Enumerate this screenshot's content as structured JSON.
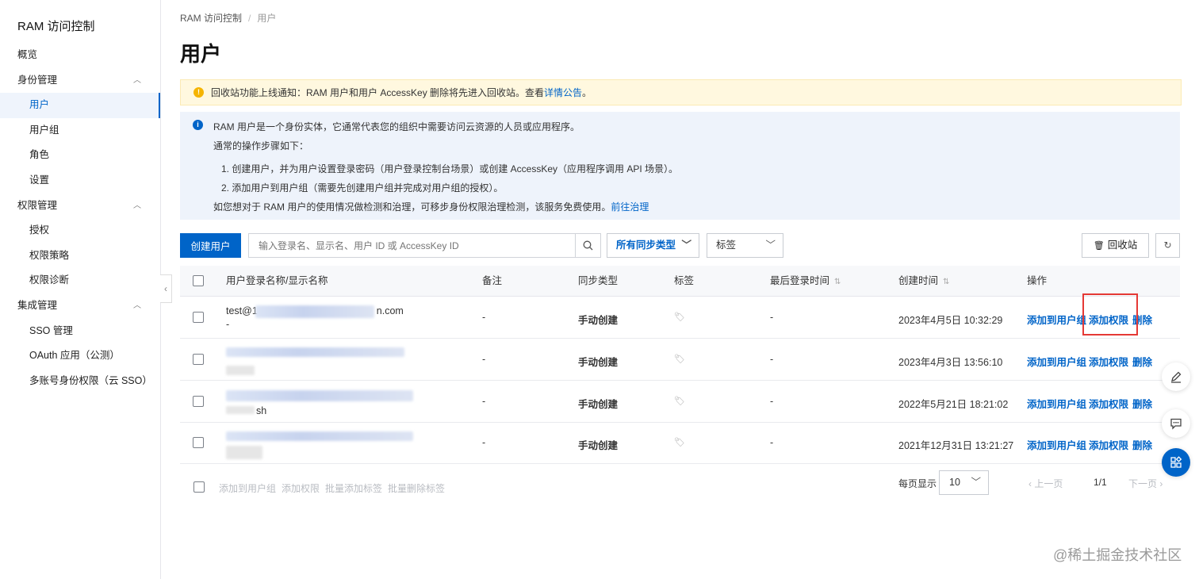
{
  "sidebar": {
    "title": "RAM 访问控制",
    "items": [
      {
        "label": "概览",
        "kind": "group"
      },
      {
        "label": "身份管理",
        "kind": "group",
        "expanded": true
      },
      {
        "label": "用户",
        "kind": "child",
        "active": true
      },
      {
        "label": "用户组",
        "kind": "child"
      },
      {
        "label": "角色",
        "kind": "child"
      },
      {
        "label": "设置",
        "kind": "child"
      },
      {
        "label": "权限管理",
        "kind": "group",
        "expanded": true
      },
      {
        "label": "授权",
        "kind": "child"
      },
      {
        "label": "权限策略",
        "kind": "child"
      },
      {
        "label": "权限诊断",
        "kind": "child"
      },
      {
        "label": "集成管理",
        "kind": "group",
        "expanded": true
      },
      {
        "label": "SSO 管理",
        "kind": "child"
      },
      {
        "label": "OAuth 应用（公测）",
        "kind": "child"
      },
      {
        "label": "多账号身份权限（云 SSO）",
        "kind": "child"
      }
    ]
  },
  "breadcrumb": {
    "root": "RAM 访问控制",
    "sep": "/",
    "current": "用户"
  },
  "page_title": "用户",
  "notice_yellow": {
    "text": "回收站功能上线通知：RAM 用户和用户 AccessKey 删除将先进入回收站。查看",
    "link": "详情公告",
    "end": "。"
  },
  "notice_blue": {
    "line1": "RAM 用户是一个身份实体，它通常代表您的组织中需要访问云资源的人员或应用程序。",
    "line2": "通常的操作步骤如下：",
    "step1": "1. 创建用户，并为用户设置登录密码（用户登录控制台场景）或创建 AccessKey（应用程序调用 API 场景）。",
    "step2": "2. 添加用户到用户组（需要先创建用户组并完成对用户组的授权）。",
    "line5": "如您想对于 RAM 用户的使用情况做检测和治理，可移步身份权限治理检测，该服务免费使用。",
    "line5_link": "前往治理"
  },
  "toolbar": {
    "create_label": "创建用户",
    "search_placeholder": "输入登录名、显示名、用户 ID 或 AccessKey ID",
    "sync_type_select": "所有同步类型",
    "tag_select": "标签",
    "recycle_label": "回收站"
  },
  "table": {
    "headers": {
      "name": "用户登录名称/显示名称",
      "remark": "备注",
      "sync": "同步类型",
      "tag": "标签",
      "last_login": "最后登录时间",
      "created": "创建时间",
      "ops": "操作"
    },
    "rows": [
      {
        "login": "test@1",
        "login_tail": "n.com",
        "display": "-",
        "remark": "-",
        "sync": "手动创建",
        "last_login": "-",
        "created": "2023年4月5日 10:32:29"
      },
      {
        "login": "",
        "display": "",
        "remark": "-",
        "sync": "手动创建",
        "last_login": "-",
        "created": "2023年4月3日 13:56:10"
      },
      {
        "login": "",
        "display": "sh",
        "remark": "-",
        "sync": "手动创建",
        "last_login": "-",
        "created": "2022年5月21日 18:21:02"
      },
      {
        "login": "",
        "display": "",
        "remark": "-",
        "sync": "手动创建",
        "last_login": "-",
        "created": "2021年12月31日 13:21:27"
      }
    ],
    "actions": {
      "add_group": "添加到用户组",
      "add_perm": "添加权限",
      "delete": "删除"
    }
  },
  "footer": {
    "batch": [
      "添加到用户组",
      "添加权限",
      "批量添加标签",
      "批量删除标签"
    ],
    "page_size_label": "每页显示",
    "page_size": "10",
    "prev": "上一页",
    "position": "1/1",
    "next": "下一页"
  },
  "watermark": "@稀土掘金技术社区",
  "colors": {
    "primary": "#0064c8",
    "highlight": "#e53935",
    "notice_yellow": "#fff8df",
    "notice_blue": "#eef3fb"
  }
}
